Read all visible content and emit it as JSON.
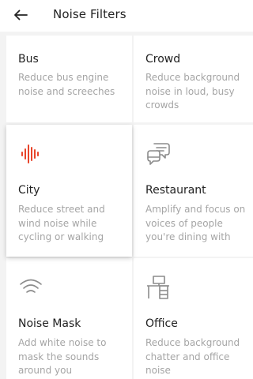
{
  "header": {
    "title": "Noise Filters"
  },
  "tiles": [
    {
      "name": "Bus",
      "desc": "Reduce bus engine noise and screeches"
    },
    {
      "name": "Crowd",
      "desc": "Reduce background noise in loud, busy crowds"
    },
    {
      "name": "City",
      "desc": "Reduce street and wind noise while cycling or walking",
      "icon": "sound-wave-icon",
      "selected": true
    },
    {
      "name": "Restaurant",
      "desc": "Amplify and focus on voices of people you're dining with",
      "icon": "chat-bubbles-icon"
    },
    {
      "name": "Noise Mask",
      "desc": "Add white noise to mask the sounds around you",
      "icon": "wifi-waves-icon"
    },
    {
      "name": "Office",
      "desc": "Reduce background chatter and office noise",
      "icon": "desk-icon"
    }
  ],
  "colors": {
    "accent": "#e8442a",
    "icon_gray": "#8c8c8c",
    "background": "#f3f3f3"
  }
}
